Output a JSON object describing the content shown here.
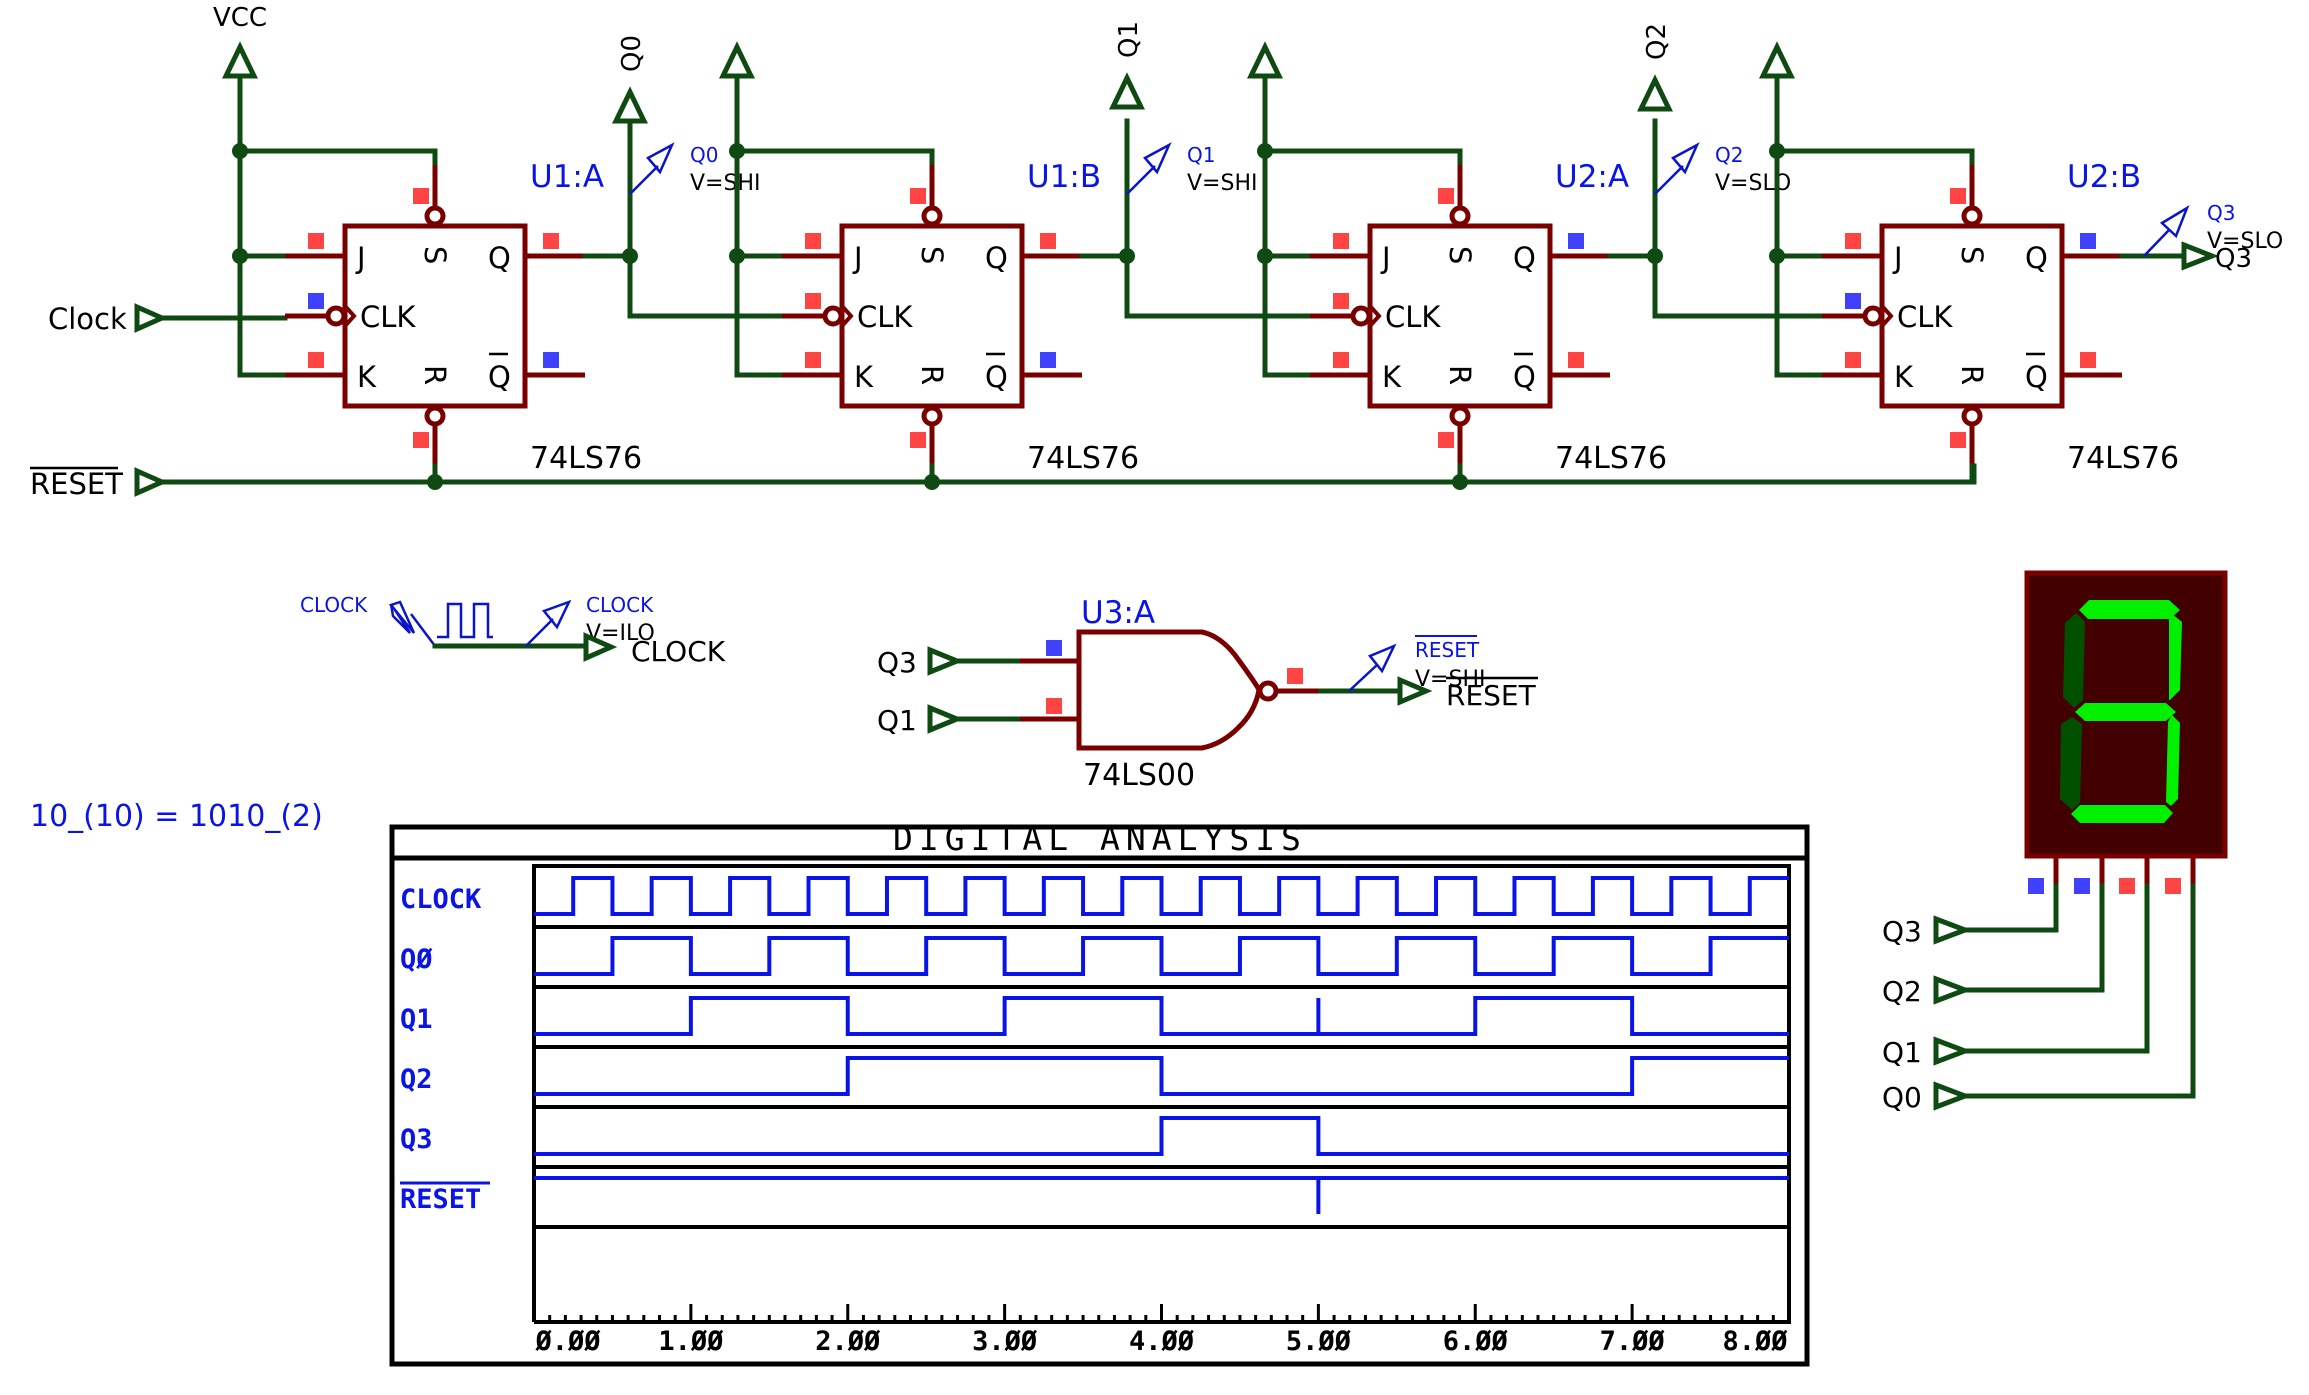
{
  "power": {
    "vcc_label": "VCC"
  },
  "inputs": {
    "clock_label": "Clock",
    "reset_label": "RESET"
  },
  "flipflops": [
    {
      "ref": "U1:A",
      "part": "74LS76",
      "probe_name": "Q0",
      "probe_value": "V=SHI",
      "output_label": "Q0",
      "pins": {
        "j": "J",
        "s": "S",
        "q": "Q",
        "clk": "CLK",
        "k": "K",
        "r": "R",
        "qbar": "Q"
      },
      "pin_states": {
        "s": "high",
        "j": "high",
        "clk": "low",
        "k": "high",
        "r": "high",
        "q": "high",
        "qbar": "low"
      }
    },
    {
      "ref": "U1:B",
      "part": "74LS76",
      "probe_name": "Q1",
      "probe_value": "V=SHI",
      "output_label": "Q1",
      "pins": {
        "j": "J",
        "s": "S",
        "q": "Q",
        "clk": "CLK",
        "k": "K",
        "r": "R",
        "qbar": "Q"
      },
      "pin_states": {
        "s": "high",
        "j": "high",
        "clk": "high",
        "k": "high",
        "r": "high",
        "q": "high",
        "qbar": "low"
      }
    },
    {
      "ref": "U2:A",
      "part": "74LS76",
      "probe_name": "Q2",
      "probe_value": "V=SLO",
      "output_label": "Q2",
      "pins": {
        "j": "J",
        "s": "S",
        "q": "Q",
        "clk": "CLK",
        "k": "K",
        "r": "R",
        "qbar": "Q"
      },
      "pin_states": {
        "s": "high",
        "j": "high",
        "clk": "high",
        "k": "high",
        "r": "high",
        "q": "low",
        "qbar": "high"
      }
    },
    {
      "ref": "U2:B",
      "part": "74LS76",
      "probe_name": "Q3",
      "probe_value": "V=SLO",
      "output_label": "Q3",
      "pins": {
        "j": "J",
        "s": "S",
        "q": "Q",
        "clk": "CLK",
        "k": "K",
        "r": "R",
        "qbar": "Q"
      },
      "pin_states": {
        "s": "high",
        "j": "high",
        "clk": "low",
        "k": "high",
        "r": "high",
        "q": "low",
        "qbar": "high"
      }
    }
  ],
  "clock_gen": {
    "source_label": "CLOCK",
    "probe_name": "CLOCK",
    "probe_value": "V=ILO",
    "terminal_label": "CLOCK"
  },
  "nand": {
    "ref": "U3:A",
    "part": "74LS00",
    "inputs": [
      "Q3",
      "Q1"
    ],
    "input_states": [
      "low",
      "high"
    ],
    "output_state": "high",
    "probe_name": "RESET",
    "probe_value": "V=SHI",
    "terminal_label": "RESET"
  },
  "display": {
    "inputs": [
      "Q3",
      "Q2",
      "Q1",
      "Q0"
    ],
    "pin_states": [
      "low",
      "low",
      "high",
      "high"
    ],
    "segments": {
      "a": true,
      "b": true,
      "c": true,
      "d": true,
      "e": false,
      "f": false,
      "g": true
    },
    "colors": {
      "on": "#00f000",
      "off": "#005000",
      "bg": "#420000",
      "border": "#7a0000"
    }
  },
  "annotation": "10_(10) = 1010_(2)",
  "analysis": {
    "title": "DIGITAL ANALYSIS",
    "signals": [
      {
        "name": "CLOCK",
        "overline": false
      },
      {
        "name": "QØ",
        "overline": false
      },
      {
        "name": "Q1",
        "overline": false
      },
      {
        "name": "Q2",
        "overline": false
      },
      {
        "name": "Q3",
        "overline": false
      },
      {
        "name": "RESET",
        "overline": true
      }
    ],
    "tick_labels": [
      "Ø.ØØ",
      "1.ØØ",
      "2.ØØ",
      "3.ØØ",
      "4.ØØ",
      "5.ØØ",
      "6.ØØ",
      "7.ØØ",
      "8.ØØ"
    ]
  },
  "chart_data": {
    "type": "line",
    "title": "DIGITAL ANALYSIS",
    "xlabel": "",
    "ylabel": "",
    "xlim": [
      0,
      8
    ],
    "x_major_ticks": [
      0,
      1,
      2,
      3,
      4,
      5,
      6,
      7,
      8
    ],
    "x_minor_step": 0.1,
    "series": [
      {
        "name": "CLOCK",
        "initial": 0,
        "transitions": [
          0.25,
          0.5,
          0.75,
          1.0,
          1.25,
          1.5,
          1.75,
          2.0,
          2.25,
          2.5,
          2.75,
          3.0,
          3.25,
          3.5,
          3.75,
          4.0,
          4.25,
          4.5,
          4.75,
          5.0,
          5.25,
          5.5,
          5.75,
          6.0,
          6.25,
          6.5,
          6.75,
          7.0,
          7.25,
          7.5,
          7.75
        ],
        "glitches": []
      },
      {
        "name": "Q0",
        "initial": 0,
        "transitions": [
          0.5,
          1.0,
          1.5,
          2.0,
          2.5,
          3.0,
          3.5,
          4.0,
          4.5,
          5.0,
          5.5,
          6.0,
          6.5,
          7.0,
          7.5
        ],
        "glitches": []
      },
      {
        "name": "Q1",
        "initial": 0,
        "transitions": [
          1.0,
          2.0,
          3.0,
          4.0,
          6.0,
          7.0
        ],
        "glitches": [
          5.0
        ]
      },
      {
        "name": "Q2",
        "initial": 0,
        "transitions": [
          2.0,
          4.0,
          7.0
        ],
        "glitches": []
      },
      {
        "name": "Q3",
        "initial": 0,
        "transitions": [
          4.0,
          5.0
        ],
        "glitches": []
      },
      {
        "name": "RESET",
        "initial": 1,
        "transitions": [],
        "glitches": [
          5.0
        ]
      }
    ]
  }
}
